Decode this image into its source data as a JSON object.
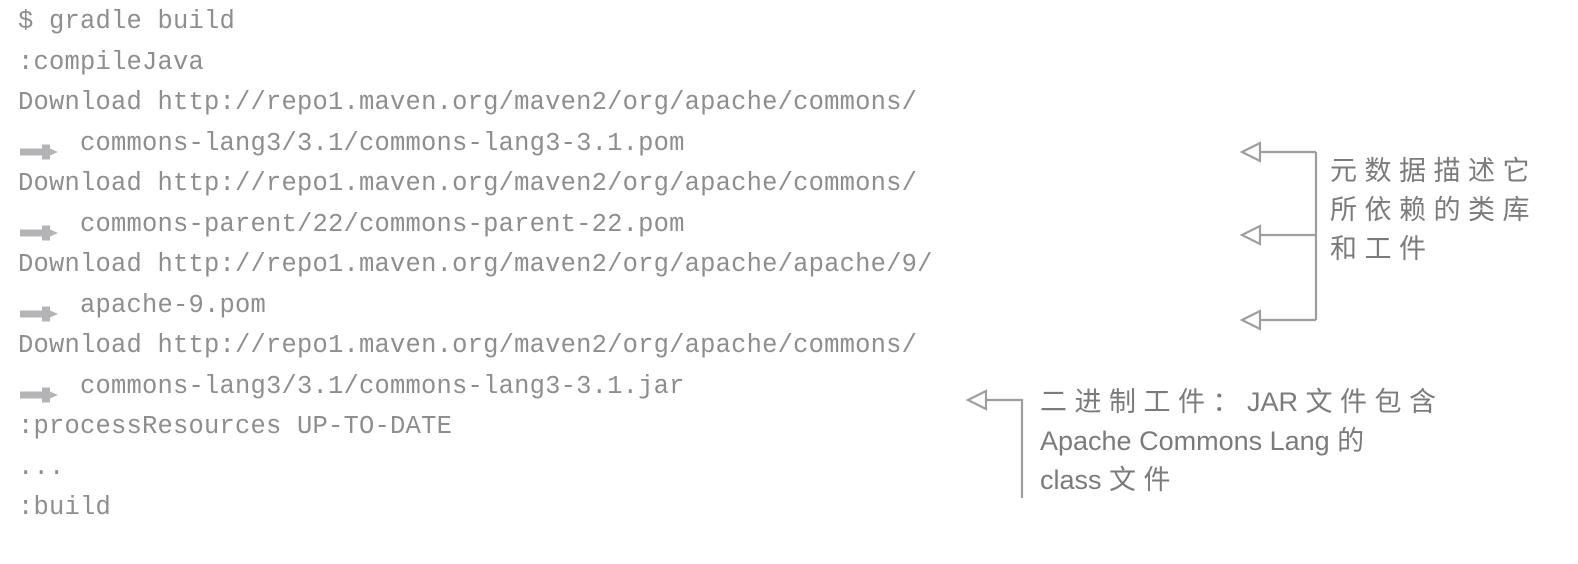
{
  "console": {
    "lines": [
      {
        "text": "$ gradle build",
        "continuation": false
      },
      {
        "text": ":compileJava",
        "continuation": false
      },
      {
        "text": "Download http://repo1.maven.org/maven2/org/apache/commons/",
        "continuation": false
      },
      {
        "text": "commons-lang3/3.1/commons-lang3-3.1.pom",
        "continuation": true
      },
      {
        "text": "Download http://repo1.maven.org/maven2/org/apache/commons/",
        "continuation": false
      },
      {
        "text": "commons-parent/22/commons-parent-22.pom",
        "continuation": true
      },
      {
        "text": "Download http://repo1.maven.org/maven2/org/apache/apache/9/",
        "continuation": false
      },
      {
        "text": "apache-9.pom",
        "continuation": true
      },
      {
        "text": "Download http://repo1.maven.org/maven2/org/apache/commons/",
        "continuation": false
      },
      {
        "text": "commons-lang3/3.1/commons-lang3-3.1.jar",
        "continuation": true
      },
      {
        "text": ":processResources UP-TO-DATE",
        "continuation": false
      },
      {
        "text": "...",
        "continuation": false
      },
      {
        "text": ":build",
        "continuation": false
      }
    ]
  },
  "callouts": [
    {
      "id": "metadata-callout",
      "lines": [
        "元 数 据 描 述 它",
        "所 依 赖 的 类 库",
        "和 工 件"
      ]
    },
    {
      "id": "binary-artifact-callout",
      "lines": [
        "二 进 制 工 件 ： JAR 文 件 包 含",
        "Apache Commons Lang 的",
        "class 文 件"
      ]
    }
  ],
  "icons": {
    "continuation_arrow": "arrow-right-icon",
    "leader_arrow": "arrow-left-outline-icon"
  },
  "colors": {
    "text": "#8e8e90",
    "callout_text": "#7b7b7d",
    "leader": "#9e9e9f",
    "background": "#ffffff"
  }
}
